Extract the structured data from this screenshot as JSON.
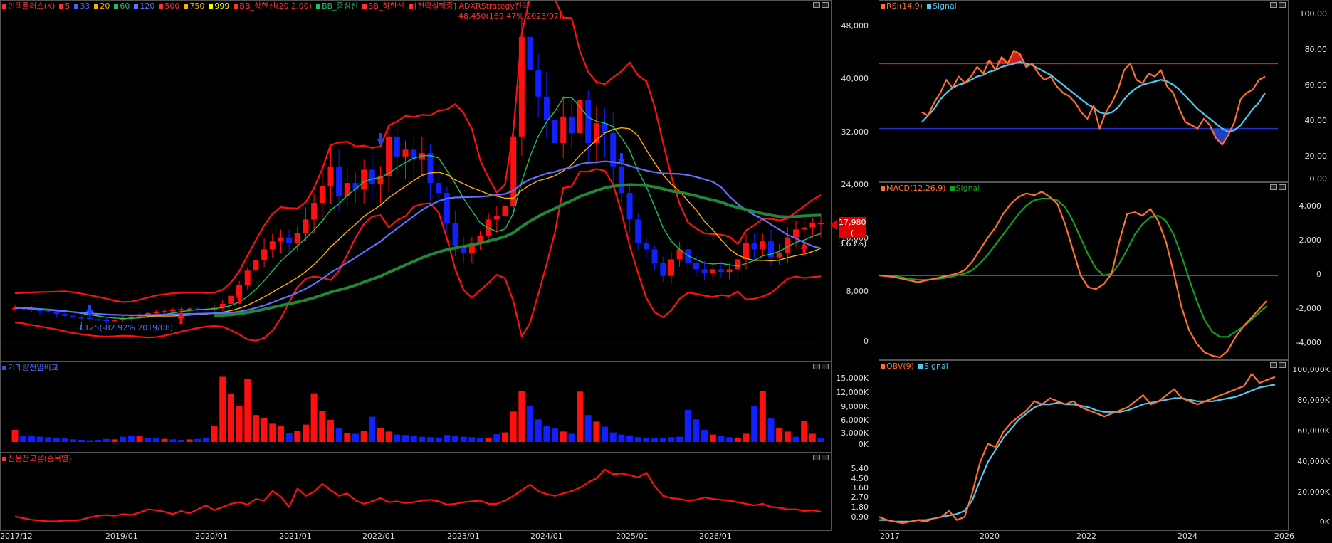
{
  "main": {
    "legend": [
      {
        "text": "인텍플러스(K)",
        "color": "#ff3030"
      },
      {
        "text": "5",
        "color": "#ff3030"
      },
      {
        "text": "33",
        "color": "#5060ff"
      },
      {
        "text": "20",
        "color": "#ffb000"
      },
      {
        "text": "60",
        "color": "#20c060"
      },
      {
        "text": "120",
        "color": "#6070ff"
      },
      {
        "text": "500",
        "color": "#ff3030"
      },
      {
        "text": "750",
        "color": "#ffb000"
      },
      {
        "text": "999",
        "color": "#ffff00"
      },
      {
        "text": "BB_상한선(20,2.00)",
        "color": "#ff3030"
      },
      {
        "text": "BB_중심선",
        "color": "#20c060"
      },
      {
        "text": "BB_하한선",
        "color": "#ff3030"
      },
      {
        "text": "[전략실행중] ADXRStrategy전략",
        "color": "#ff3030"
      }
    ],
    "high_note": "48,450(169.47% 2023/07)",
    "low_note": "3,125(-82.92% 2019/08)",
    "y_ticks": [
      "48,000",
      "40,000",
      "32,000",
      "24,000",
      "16,000",
      "8,000",
      "0"
    ],
    "price_badge_value": "17,980",
    "price_badge_pct": "( 3.63%)",
    "colors": {
      "up": "#ff1010",
      "down": "#1020ff",
      "bb": "#ff1010",
      "ma20": "#ffb000",
      "ma60": "#20c060",
      "ma120": "#6070ff",
      "ma500": "#208838"
    }
  },
  "volume": {
    "legend": "거래량전일비교",
    "y_ticks": [
      "15,000K",
      "12,000K",
      "9,000K",
      "6,000K",
      "3,000K",
      "0K"
    ]
  },
  "credit": {
    "legend": "신용잔고율(종목별)",
    "y_ticks": [
      "5.40",
      "4.50",
      "3.60",
      "2.70",
      "1.80",
      "0.90"
    ]
  },
  "x_axis": [
    "2017/12",
    "2019/01",
    "2020/01",
    "2021/01",
    "2022/01",
    "2023/01",
    "2024/01",
    "2025/01",
    "2026/01"
  ],
  "rsi": {
    "legend": [
      {
        "text": "RSI(14,9)",
        "color": "#ff7030"
      },
      {
        "text": "Signal",
        "color": "#50c8f0"
      }
    ],
    "y_ticks": [
      "100.00",
      "80.00",
      "60.00",
      "40.00",
      "20.00",
      "0.00"
    ]
  },
  "macd": {
    "legend": [
      {
        "text": "MACD(12,26,9)",
        "color": "#ff7030"
      },
      {
        "text": "Signal",
        "color": "#10a020"
      }
    ],
    "y_ticks": [
      "4,000",
      "2,000",
      "0",
      "-2,000",
      "-4,000"
    ]
  },
  "obv": {
    "legend": [
      {
        "text": "OBV(9)",
        "color": "#ff7030"
      },
      {
        "text": "Signal",
        "color": "#50c8f0"
      }
    ],
    "y_ticks": [
      "100,000K",
      "80,000K",
      "60,000K",
      "40,000K",
      "20,000K",
      "0K"
    ]
  },
  "right_x_axis": [
    "2017",
    "2020",
    "2022",
    "2024",
    "2026"
  ]
}
